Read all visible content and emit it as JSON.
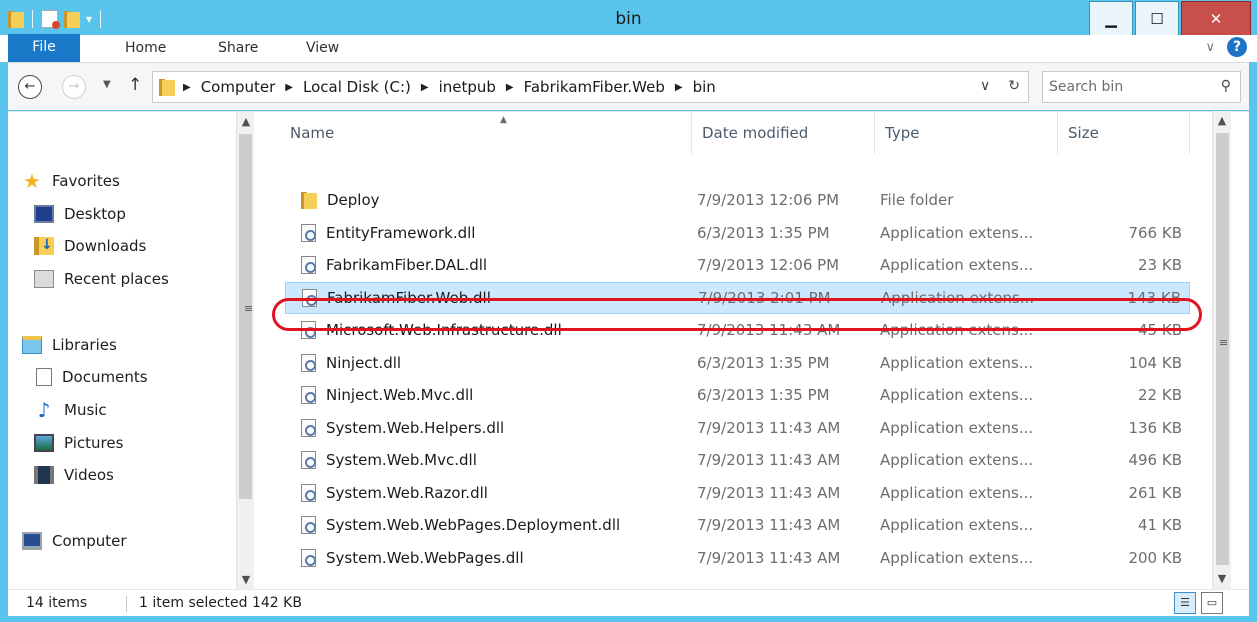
{
  "window": {
    "title": "bin",
    "minimize": "▁",
    "maximize": "☐",
    "close": "✕"
  },
  "ribbon": {
    "tabs": [
      "File",
      "Home",
      "Share",
      "View"
    ],
    "expand_icon": "∨",
    "help": "?"
  },
  "address": {
    "crumbs": [
      "Computer",
      "Local Disk (C:)",
      "inetpub",
      "FabrikamFiber.Web",
      "bin"
    ],
    "dropdown": "∨",
    "refresh": "↻"
  },
  "search": {
    "placeholder": "Search bin"
  },
  "navpane": {
    "favorites": "Favorites",
    "desktop": "Desktop",
    "downloads": "Downloads",
    "recent_places": "Recent places",
    "libraries": "Libraries",
    "documents": "Documents",
    "music": "Music",
    "pictures": "Pictures",
    "videos": "Videos",
    "computer": "Computer"
  },
  "columns": {
    "name": "Name",
    "date": "Date modified",
    "type": "Type",
    "size": "Size"
  },
  "files": [
    {
      "name": "Deploy",
      "date": "7/9/2013 12:06 PM",
      "type": "File folder",
      "size": "",
      "icon": "folder-icon"
    },
    {
      "name": "EntityFramework.dll",
      "date": "6/3/2013 1:35 PM",
      "type": "Application extens...",
      "size": "766 KB",
      "icon": "dll-icon"
    },
    {
      "name": "FabrikamFiber.DAL.dll",
      "date": "7/9/2013 12:06 PM",
      "type": "Application extens...",
      "size": "23 KB",
      "icon": "dll-icon"
    },
    {
      "name": "FabrikamFiber.Web.dll",
      "date": "7/9/2013 2:01 PM",
      "type": "Application extens...",
      "size": "143 KB",
      "icon": "dll-icon",
      "selected": true
    },
    {
      "name": "Microsoft.Web.Infrastructure.dll",
      "date": "7/9/2013 11:43 AM",
      "type": "Application extens...",
      "size": "45 KB",
      "icon": "dll-icon"
    },
    {
      "name": "Ninject.dll",
      "date": "6/3/2013 1:35 PM",
      "type": "Application extens...",
      "size": "104 KB",
      "icon": "dll-icon"
    },
    {
      "name": "Ninject.Web.Mvc.dll",
      "date": "6/3/2013 1:35 PM",
      "type": "Application extens...",
      "size": "22 KB",
      "icon": "dll-icon"
    },
    {
      "name": "System.Web.Helpers.dll",
      "date": "7/9/2013 11:43 AM",
      "type": "Application extens...",
      "size": "136 KB",
      "icon": "dll-icon"
    },
    {
      "name": "System.Web.Mvc.dll",
      "date": "7/9/2013 11:43 AM",
      "type": "Application extens...",
      "size": "496 KB",
      "icon": "dll-icon"
    },
    {
      "name": "System.Web.Razor.dll",
      "date": "7/9/2013 11:43 AM",
      "type": "Application extens...",
      "size": "261 KB",
      "icon": "dll-icon"
    },
    {
      "name": "System.Web.WebPages.Deployment.dll",
      "date": "7/9/2013 11:43 AM",
      "type": "Application extens...",
      "size": "41 KB",
      "icon": "dll-icon"
    },
    {
      "name": "System.Web.WebPages.dll",
      "date": "7/9/2013 11:43 AM",
      "type": "Application extens...",
      "size": "200 KB",
      "icon": "dll-icon"
    }
  ],
  "status": {
    "count": "14 items",
    "selection": "1 item selected  142 KB"
  },
  "colors": {
    "titlebar": "#59c5ec",
    "file_tab": "#1978c7",
    "selection": "#cce8ff",
    "highlight_ring": "#e0141e"
  }
}
